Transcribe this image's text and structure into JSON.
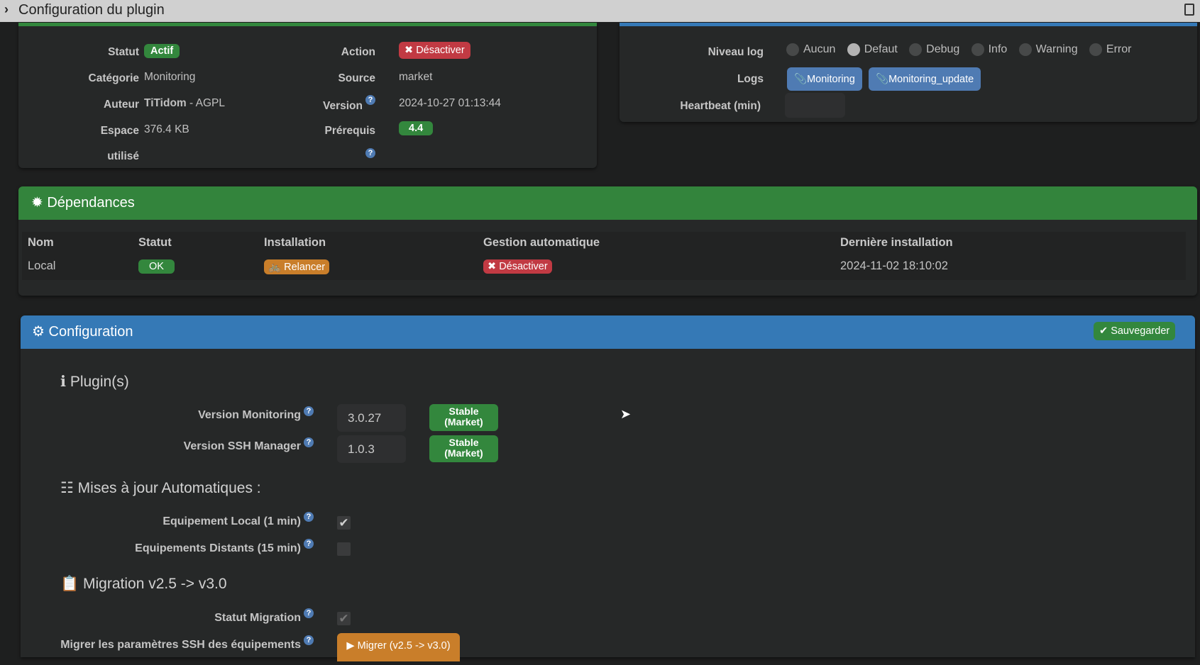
{
  "window": {
    "title": "Configuration du plugin"
  },
  "info": {
    "statut_label": "Statut",
    "statut_value": "Actif",
    "categorie_label": "Catégorie",
    "categorie_value": "Monitoring",
    "auteur_label": "Auteur",
    "auteur_name": "TiTidom",
    "auteur_license": " - AGPL",
    "espace_label_1": "Espace",
    "espace_label_2": "utilisé",
    "espace_value": "376.4 KB",
    "action_label": "Action",
    "action_button": "Désactiver",
    "source_label": "Source",
    "source_value": "market",
    "version_label": "Version",
    "version_value": "2024-10-27 01:13:44",
    "prerequis_label": "Prérequis",
    "prerequis_value": "4.4"
  },
  "logs": {
    "niveau_label": "Niveau log",
    "levels": [
      "Aucun",
      "Defaut",
      "Debug",
      "Info",
      "Warning",
      "Error"
    ],
    "selected": "Defaut",
    "logs_label": "Logs",
    "log_buttons": [
      "Monitoring",
      "Monitoring_update"
    ],
    "heartbeat_label": "Heartbeat (min)",
    "heartbeat_value": ""
  },
  "dependances": {
    "title": "Dépendances",
    "headers": [
      "Nom",
      "Statut",
      "Installation",
      "Gestion automatique",
      "Dernière installation"
    ],
    "row": {
      "nom": "Local",
      "statut": "OK",
      "installation": "Relancer",
      "gestion": "Désactiver",
      "derniere": "2024-11-02 18:10:02"
    }
  },
  "configuration": {
    "title": "Configuration",
    "save": "Sauvegarder",
    "plugins_title": "Plugin(s)",
    "version_monitoring_label": "Version Monitoring",
    "version_monitoring_value": "3.0.27",
    "version_ssh_label": "Version SSH Manager",
    "version_ssh_value": "1.0.3",
    "stable_line1": "Stable",
    "stable_line2": "(Market)",
    "maj_title": "Mises à jour Automatiques :",
    "equip_local_label": "Equipement Local (1 min)",
    "equip_local_checked": true,
    "equip_distants_label": "Equipements Distants (15 min)",
    "equip_distants_checked": false,
    "migration_title": "Migration v2.5 -> v3.0",
    "statut_migration_label": "Statut Migration",
    "statut_migration_checked": true,
    "migrer_label": "Migrer les paramètres SSH des équipements",
    "migrer_button": "Migrer (v2.5 -> v3.0)"
  },
  "help": "?",
  "colors": {
    "green": "#33873d",
    "red": "#c13a43",
    "orange": "#c97e2a",
    "blue": "#3579b6"
  }
}
